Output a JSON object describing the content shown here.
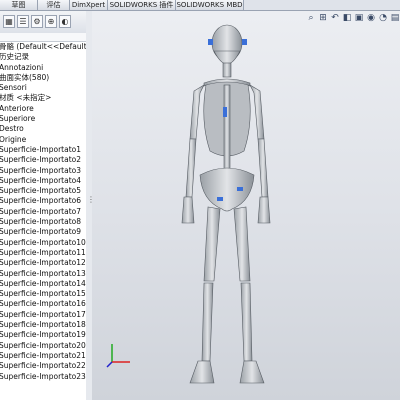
{
  "tabs": [
    "草图",
    "评估",
    "DimXpert",
    "SOLIDWORKS 插件",
    "SOLIDWORKS MBD"
  ],
  "panel": {
    "toolbar_icons": [
      "feature-manager-icon",
      "property-manager-icon",
      "configuration-manager-icon",
      "dimxpert-icon",
      "display-manager-icon"
    ],
    "tree": [
      "骨骼  (Default<<Default",
      "历史记录",
      "Annotazioni",
      "曲面实体(580)",
      "Sensori",
      "材质 <未指定>",
      "Anteriore",
      "Superiore",
      "Destro",
      "Origine",
      "Superficie-Importato1",
      "Superficie-Importato2",
      "Superficie-Importato3",
      "Superficie-Importato4",
      "Superficie-Importato5",
      "Superficie-Importato6",
      "Superficie-Importato7",
      "Superficie-Importato8",
      "Superficie-Importato9",
      "Superficie-Importato10",
      "Superficie-Importato11",
      "Superficie-Importato12",
      "Superficie-Importato13",
      "Superficie-Importato14",
      "Superficie-Importato15",
      "Superficie-Importato16",
      "Superficie-Importato17",
      "Superficie-Importato18",
      "Superficie-Importato19",
      "Superficie-Importato20",
      "Superficie-Importato21",
      "Superficie-Importato22",
      "Superficie-Importato23"
    ]
  },
  "colors": {
    "bone": "#c9ccd0",
    "bone_shade": "#8e939a",
    "selection": "#3a6fd8",
    "axis_x": "#d22",
    "axis_y": "#2a2",
    "axis_z": "#22c"
  }
}
